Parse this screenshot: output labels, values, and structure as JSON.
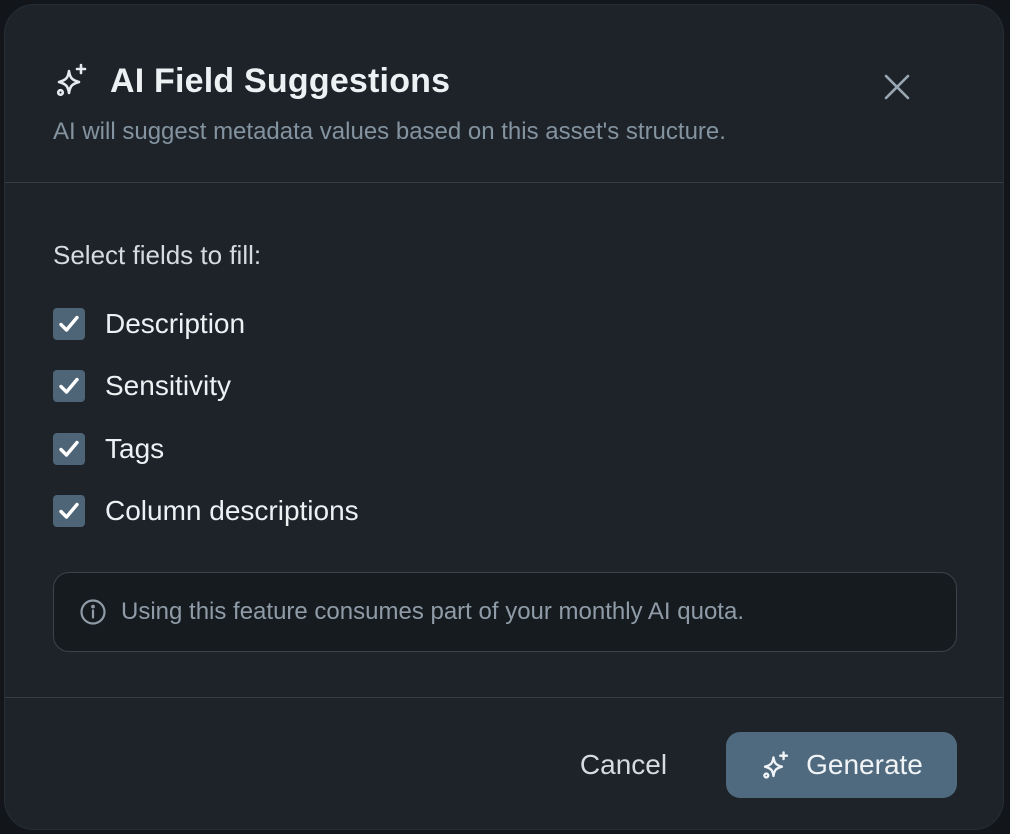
{
  "dialog": {
    "title": "AI Field Suggestions",
    "subtitle": "AI will suggest metadata values based on this asset's structure.",
    "title_icon": "sparkles-icon",
    "close_icon": "close-icon"
  },
  "fields": {
    "label": "Select fields to fill:",
    "options": [
      {
        "label": "Description",
        "checked": true
      },
      {
        "label": "Sensitivity",
        "checked": true
      },
      {
        "label": "Tags",
        "checked": true
      },
      {
        "label": "Column descriptions",
        "checked": true
      }
    ]
  },
  "info": {
    "icon": "info-icon",
    "text": "Using this feature consumes part of your monthly AI quota."
  },
  "footer": {
    "cancel_label": "Cancel",
    "generate_label": "Generate",
    "generate_icon": "sparkles-icon"
  },
  "colors": {
    "dialog_bg": "#1d2329",
    "accent": "#4f6a7e",
    "checkbox": "#4e6577"
  }
}
